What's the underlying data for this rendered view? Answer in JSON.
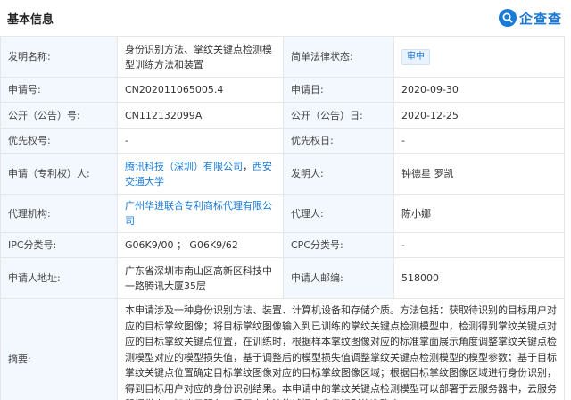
{
  "section_title": "基本信息",
  "logo": {
    "text": "企查查",
    "icon": "qcc-logo-icon",
    "color": "#1a7ad8"
  },
  "colors": {
    "label_bg": "#f2f8fe",
    "border": "#e6e6e6",
    "link": "#1a7ad8",
    "badge_bg": "#eaf3fd"
  },
  "fields": {
    "invention_name": {
      "label": "发明名称:",
      "value": "身份识别方法、掌纹关键点检测模型训练方法和装置"
    },
    "legal_status": {
      "label": "简单法律状态:",
      "value": "审中"
    },
    "application_no": {
      "label": "申请号:",
      "value": "CN202011065005.4"
    },
    "application_date": {
      "label": "申请日:",
      "value": "2020-09-30"
    },
    "publication_no": {
      "label": "公开（公告）号:",
      "value": "CN112132099A"
    },
    "publication_date": {
      "label": "公开（公告）日:",
      "value": "2020-12-25"
    },
    "priority_no": {
      "label": "优先权号:",
      "value": "-"
    },
    "priority_date": {
      "label": "优先权日:",
      "value": "-"
    },
    "applicant": {
      "label": "申请（专利权）人:",
      "items": [
        "腾讯科技（深圳）有限公司",
        "西安交通大学"
      ],
      "separator": "，"
    },
    "inventor": {
      "label": "发明人:",
      "value": "钟德星 罗凯"
    },
    "agency": {
      "label": "代理机构:",
      "value": "广州华进联合专利商标代理有限公司"
    },
    "agent": {
      "label": "代理人:",
      "value": "陈小娜"
    },
    "ipc": {
      "label": "IPC分类号:",
      "value": "G06K9/00 ； G06K9/62"
    },
    "cpc": {
      "label": "CPC分类号:",
      "value": "-"
    },
    "address": {
      "label": "申请人地址:",
      "value": "广东省深圳市南山区高新区科技中一路腾讯大厦35层"
    },
    "postcode": {
      "label": "申请人邮编:",
      "value": "518000"
    },
    "abstract": {
      "label": "摘要:",
      "value": "本申请涉及一种身份识别方法、装置、计算机设备和存储介质。方法包括：获取待识别的目标用户对应的目标掌纹图像；将目标掌纹图像输入到已训练的掌纹关键点检测模型中，检测得到掌纹关键点对应的目标掌纹关键点位置，在训练时，根据样本掌纹图像对应的标准掌面展示角度调整掌纹关键点检测模型对应的模型损失值，基于调整后的模型损失值调整掌纹关键点检测模型的模型参数；基于目标掌纹关键点位置确定目标掌纹图像对应的目标掌纹图像区域；根据目标掌纹图像区域进行身份识别，得到目标用户对应的身份识别结果。本申请中的掌纹关键点检测模型可以部署于云服务器中，云服务器提供人工智能云服务，采用本方法能够提高身份识别的准确度。"
    }
  }
}
